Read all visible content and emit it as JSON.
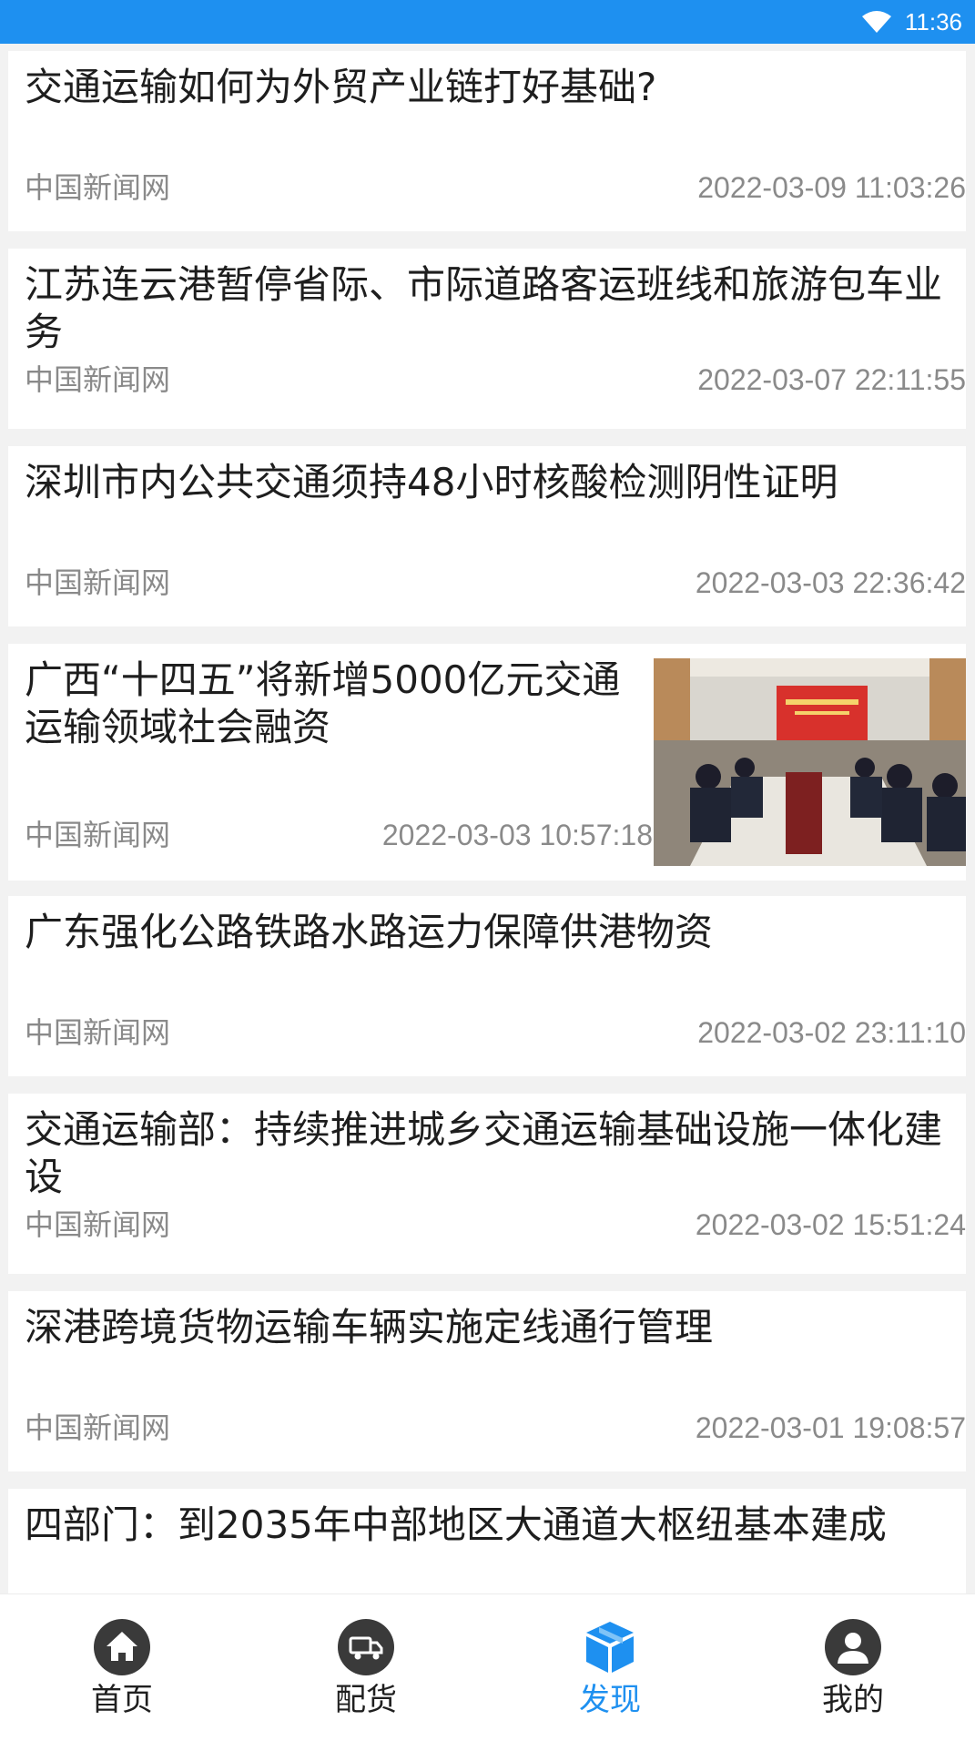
{
  "status_bar": {
    "time": "11:36",
    "wifi_icon": "wifi-icon"
  },
  "news": [
    {
      "title": "交通运输如何为外贸产业链打好基础?",
      "source": "中国新闻网",
      "time": "2022-03-09 11:03:26"
    },
    {
      "title": "江苏连云港暂停省际、市际道路客运班线和旅游包车业务",
      "source": "中国新闻网",
      "time": "2022-03-07 22:11:55"
    },
    {
      "title": "深圳市内公共交通须持48小时核酸检测阴性证明",
      "source": "中国新闻网",
      "time": "2022-03-03 22:36:42"
    },
    {
      "title": "广西“十四五”将新增5000亿元交通运输领域社会融资",
      "source": "中国新闻网",
      "time": "2022-03-03 10:57:18",
      "has_thumbnail": true
    },
    {
      "title": "广东强化公路铁路水路运力保障供港物资",
      "source": "中国新闻网",
      "time": "2022-03-02 23:11:10"
    },
    {
      "title": "交通运输部：持续推进城乡交通运输基础设施一体化建设",
      "source": "中国新闻网",
      "time": "2022-03-02 15:51:24"
    },
    {
      "title": "深港跨境货物运输车辆实施定线通行管理",
      "source": "中国新闻网",
      "time": "2022-03-01 19:08:57"
    },
    {
      "title": "四部门：到2035年中部地区大通道大枢纽基本建成",
      "source": "",
      "time": ""
    }
  ],
  "tabs": [
    {
      "label": "首页",
      "icon": "home-icon",
      "active": false
    },
    {
      "label": "配货",
      "icon": "truck-icon",
      "active": false
    },
    {
      "label": "发现",
      "icon": "cube-icon",
      "active": true
    },
    {
      "label": "我的",
      "icon": "user-icon",
      "active": false
    }
  ],
  "colors": {
    "accent": "#1e90f0",
    "inactive_icon": "#3a3a3a"
  }
}
